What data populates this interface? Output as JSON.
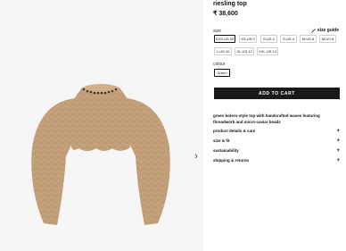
{
  "product": {
    "title": "riesling top",
    "price": "₹ 38,600",
    "description": "green bolero-style top with handcrafted waves featuring threadwork and micro-caviar beads"
  },
  "size": {
    "label": "size",
    "guide_label": "size guide",
    "options": [
      "XXS-US 00",
      "XS-US 0",
      "S-US 2",
      "S-US 4",
      "M-US 6",
      "M-US 8",
      "L-US 10",
      "XL-US 12",
      "XXL-US 14"
    ],
    "selected": "XXS-US 00"
  },
  "colour": {
    "label": "colour",
    "options": [
      "Green"
    ],
    "selected": "Green"
  },
  "cart": {
    "add_label": "ADD TO CART"
  },
  "accordion": [
    {
      "label": "product details & care",
      "icon": "+"
    },
    {
      "label": "size & fit",
      "icon": "+"
    },
    {
      "label": "sustainability",
      "icon": "+"
    },
    {
      "label": "shipping & returns",
      "icon": "+"
    }
  ],
  "gallery": {
    "next_icon": "›",
    "colors": {
      "top": "#c4a17b",
      "top_shadow": "#a98660",
      "beads": "#3a3a3a"
    }
  }
}
